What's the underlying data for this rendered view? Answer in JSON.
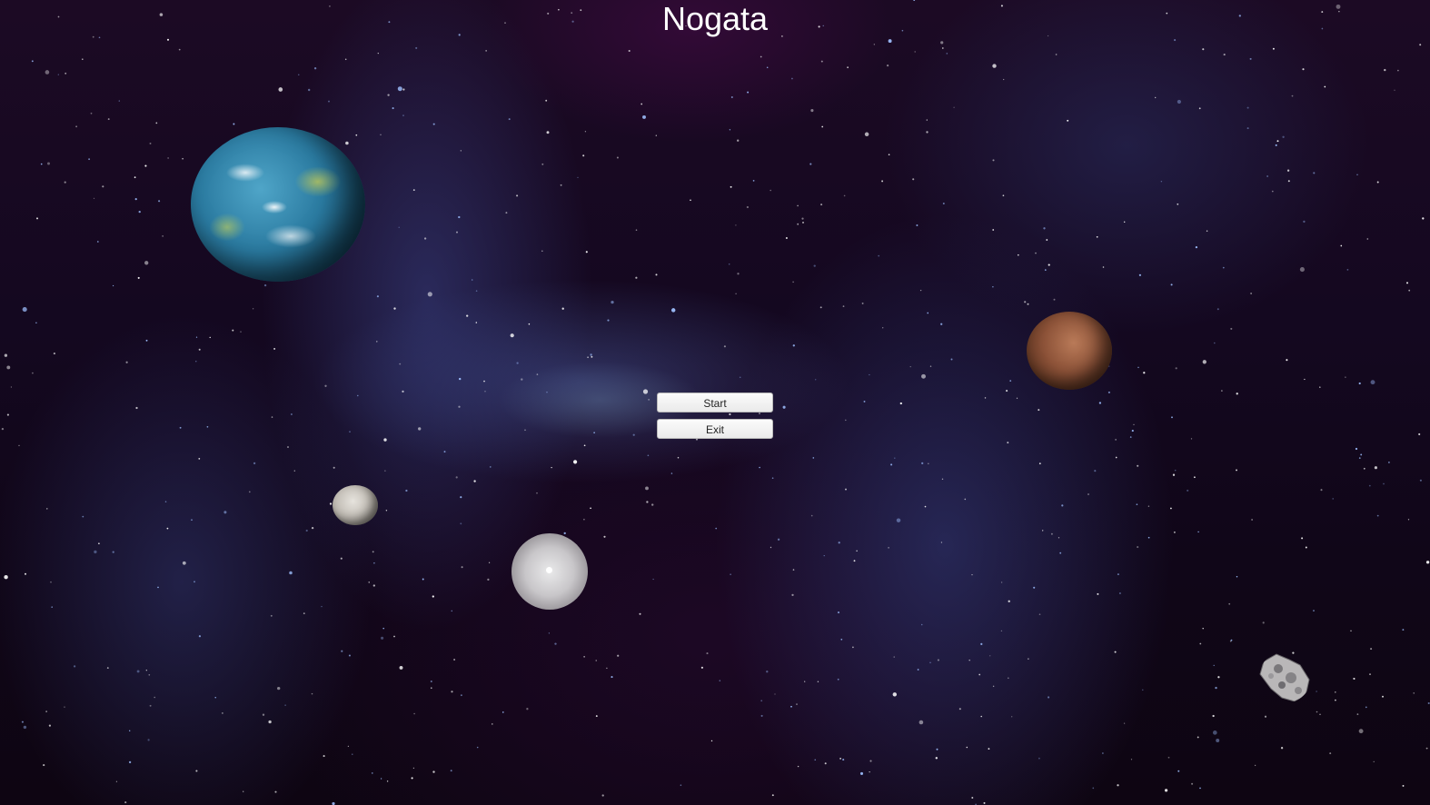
{
  "game": {
    "title": "Nogata"
  },
  "menu": {
    "start_label": "Start",
    "exit_label": "Exit"
  },
  "colors": {
    "title_text": "#ffffff",
    "button_bg": "#f2f2f2",
    "button_text": "#222222",
    "space_bg": "#140820"
  },
  "scene_objects": [
    "earth-like-planet",
    "mars-like-planet",
    "small-moon",
    "white-sphere",
    "asteroid"
  ]
}
